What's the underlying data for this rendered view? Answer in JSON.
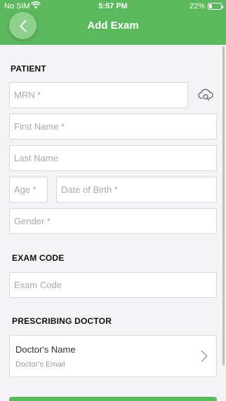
{
  "status_bar": {
    "carrier": "No SIM",
    "time": "5:57 PM",
    "battery_percent": "22%",
    "battery_level": 0.22
  },
  "header": {
    "title": "Add Exam"
  },
  "colors": {
    "header_green": "#5cb85c",
    "back_button": "#8fd08f",
    "background": "#f4f4f6"
  },
  "patient": {
    "section_title": "PATIENT",
    "mrn_placeholder": "MRN *",
    "first_name_placeholder": "First Name *",
    "last_name_placeholder": "Last Name",
    "age_placeholder": "Age *",
    "dob_placeholder": "Date of Birth *",
    "gender_placeholder": "Gender *",
    "cloud_icon": "cloud-search-icon"
  },
  "exam": {
    "section_title": "EXAM CODE",
    "code_placeholder": "Exam Code"
  },
  "doctor": {
    "section_title": "PRESCRIBING DOCTOR",
    "name": "Doctor's Name",
    "email": "Doctor's Email"
  }
}
